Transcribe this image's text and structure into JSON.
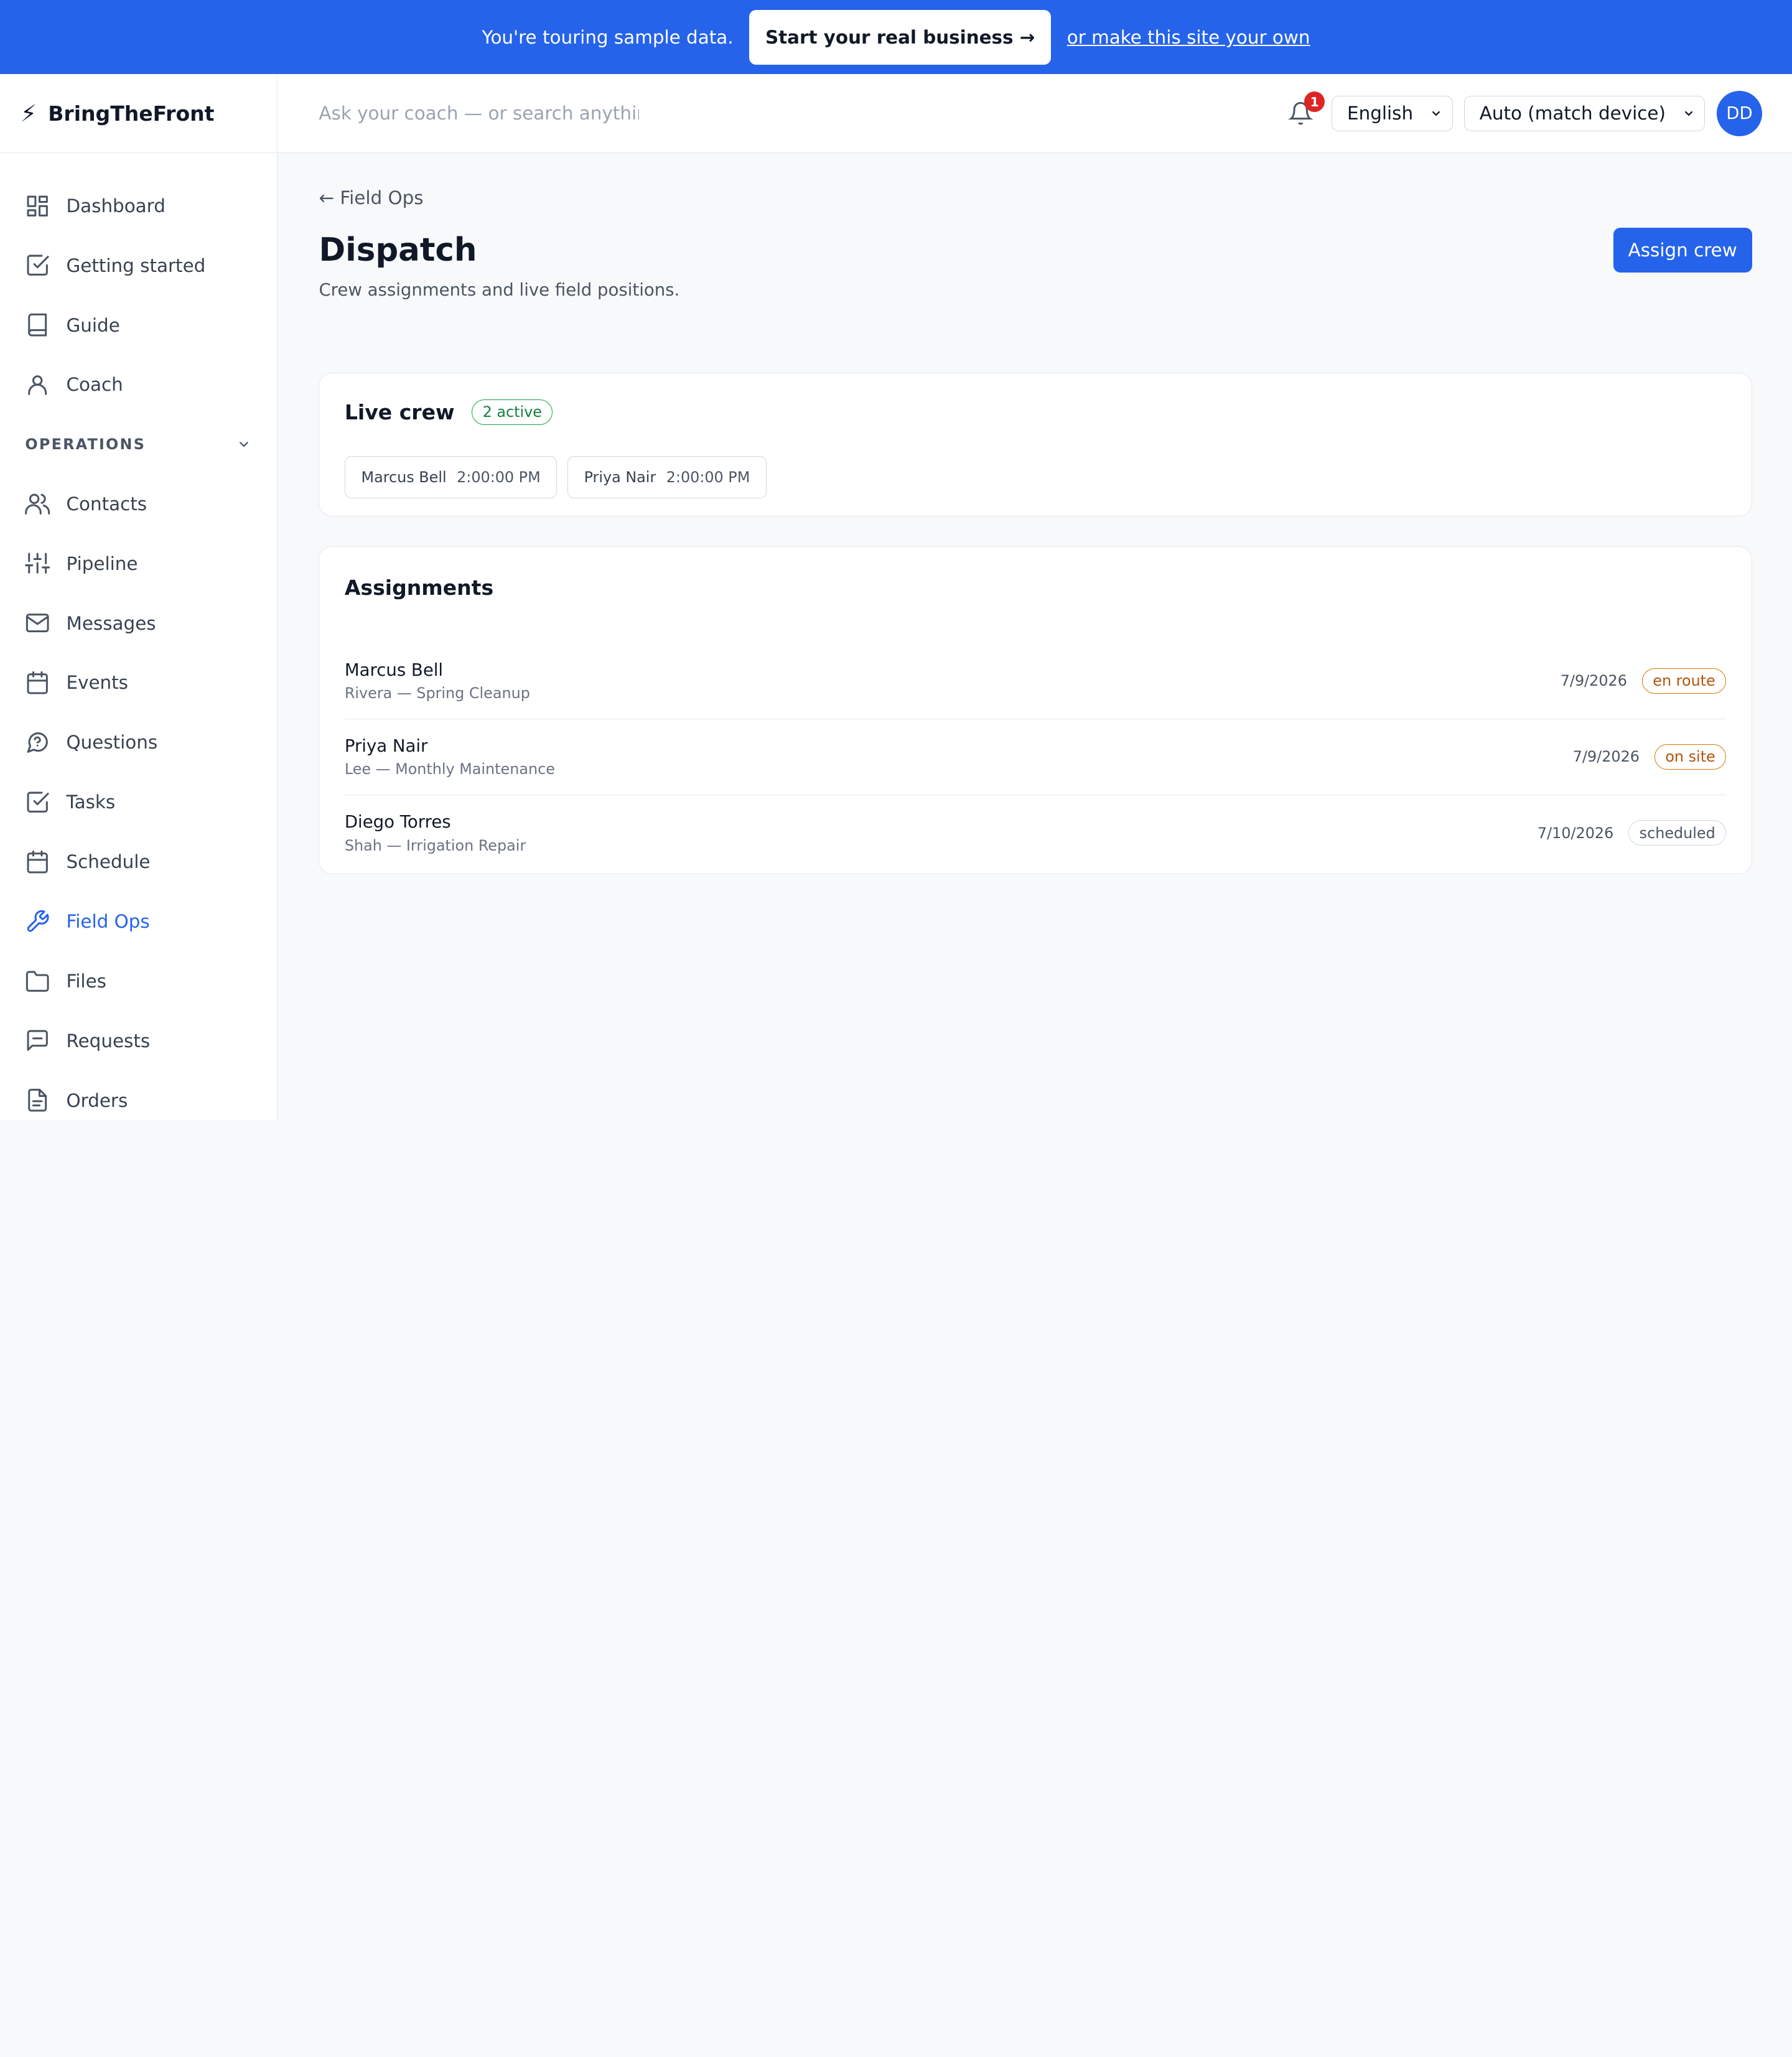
{
  "banner": {
    "text": "You're touring sample data.",
    "cta": "Start your real business →",
    "link": "or make this site your own"
  },
  "brand": {
    "name": "BringTheFront",
    "icon": "bolt-icon"
  },
  "sidebar": {
    "items_top": [
      {
        "label": "Dashboard",
        "icon": "grid-icon"
      },
      {
        "label": "Getting started",
        "icon": "check-square-icon"
      },
      {
        "label": "Guide",
        "icon": "book-icon"
      },
      {
        "label": "Coach",
        "icon": "user-icon"
      }
    ],
    "section": "OPERATIONS",
    "items_ops": [
      {
        "label": "Contacts",
        "icon": "users-icon"
      },
      {
        "label": "Pipeline",
        "icon": "sliders-icon"
      },
      {
        "label": "Messages",
        "icon": "mail-icon"
      },
      {
        "label": "Events",
        "icon": "calendar-icon"
      },
      {
        "label": "Questions",
        "icon": "help-chat-icon"
      },
      {
        "label": "Tasks",
        "icon": "check-square-icon"
      },
      {
        "label": "Schedule",
        "icon": "calendar-icon"
      },
      {
        "label": "Field Ops",
        "icon": "wrench-icon",
        "active": true
      },
      {
        "label": "Files",
        "icon": "folder-icon"
      },
      {
        "label": "Requests",
        "icon": "message-square-icon"
      },
      {
        "label": "Orders",
        "icon": "file-icon"
      }
    ]
  },
  "topbar": {
    "search_placeholder": "Ask your coach — or search anythin",
    "notifications": "1",
    "language": "English",
    "theme": "Auto (match device)",
    "avatar": "DD"
  },
  "page": {
    "back": "← Field Ops",
    "title": "Dispatch",
    "subtitle": "Crew assignments and live field positions.",
    "action": "Assign crew"
  },
  "live_crew": {
    "title": "Live crew",
    "badge": "2 active",
    "chips": [
      {
        "name": "Marcus Bell",
        "time": "2:00:00 PM"
      },
      {
        "name": "Priya Nair",
        "time": "2:00:00 PM"
      }
    ]
  },
  "assignments": {
    "title": "Assignments",
    "rows": [
      {
        "name": "Marcus Bell",
        "job": "Rivera — Spring Cleanup",
        "date": "7/9/2026",
        "status": "en route"
      },
      {
        "name": "Priya Nair",
        "job": "Lee — Monthly Maintenance",
        "date": "7/9/2026",
        "status": "on site"
      },
      {
        "name": "Diego Torres",
        "job": "Shah — Irrigation Repair",
        "date": "7/10/2026",
        "status": "scheduled"
      }
    ]
  },
  "colors": {
    "accent": "#2563eb",
    "active_badge": "#16a34a",
    "status_warn": "#d97706",
    "notification": "#dc2626"
  }
}
